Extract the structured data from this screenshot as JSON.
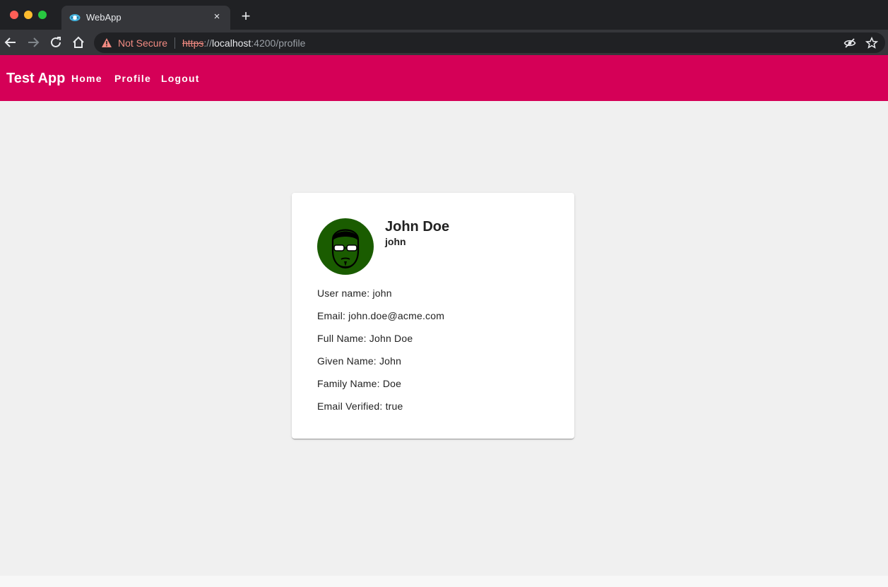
{
  "browser": {
    "tab_title": "WebApp",
    "tab_close": "×",
    "new_tab": "+",
    "security_label": "Not Secure",
    "url": {
      "scheme": "https",
      "separator": "://",
      "host": "localhost",
      "path": ":4200/profile"
    }
  },
  "app": {
    "brand": "Test App",
    "nav": [
      "Home",
      "Profile",
      "Logout"
    ],
    "accent_color": "#d50057"
  },
  "profile": {
    "display_name": "John Doe",
    "username": "john",
    "avatar_icon": "user-avatar-icon",
    "fields": [
      "User name: john",
      "Email: john.doe@acme.com",
      "Full Name: John Doe",
      "Given Name: John",
      "Family Name: Doe",
      "Email Verified: true"
    ]
  }
}
